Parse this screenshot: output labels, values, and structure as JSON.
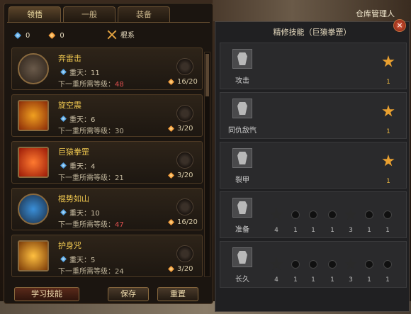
{
  "window": {
    "title": "精修技能（巨猿拳罡）",
    "warehouse_label": "仓库管理人",
    "close_label": "×"
  },
  "tabs": [
    {
      "label": "领悟"
    },
    {
      "label": "一般"
    },
    {
      "label": "装备"
    }
  ],
  "resources": {
    "blue_count": "0",
    "orange_count": "0",
    "weapon_label": "棍系"
  },
  "skills": [
    {
      "name": "奔雷击",
      "level_text": "重天：11",
      "req_prefix": "下一重所需等级：",
      "req_level": "48",
      "progress": "16/20",
      "req_red": true
    },
    {
      "name": "旋空震",
      "level_text": "重天：6",
      "req_prefix": "下一重所需等级：",
      "req_level": "30",
      "progress": "3/20",
      "req_red": false
    },
    {
      "name": "巨猿拳罡",
      "level_text": "重天：4",
      "req_prefix": "下一重所需等级：",
      "req_level": "21",
      "progress": "3/20",
      "req_red": false
    },
    {
      "name": "棍势如山",
      "level_text": "重天：10",
      "req_prefix": "下一重所需等级：",
      "req_level": "47",
      "progress": "16/20",
      "req_red": true
    },
    {
      "name": "护身咒",
      "level_text": "重天：5",
      "req_prefix": "下一重所需等级：",
      "req_level": "24",
      "progress": "3/20",
      "req_red": false
    }
  ],
  "buttons": {
    "learn": "学习技能",
    "save": "保存",
    "reset": "重置"
  },
  "refine": [
    {
      "label": "攻击",
      "counts": [
        "1"
      ]
    },
    {
      "label": "同仇敌忾",
      "counts": [
        "1"
      ]
    },
    {
      "label": "裂甲",
      "counts": [
        "1"
      ]
    },
    {
      "label": "准备",
      "counts": [
        "4",
        "1",
        "1",
        "1",
        "3",
        "1",
        "1"
      ]
    },
    {
      "label": "长久",
      "counts": [
        "4",
        "1",
        "1",
        "1",
        "3",
        "1",
        "1"
      ]
    }
  ],
  "colors": {
    "gold": "#f0c850",
    "accent_orange": "#e9a030",
    "warning_red": "#e05050"
  }
}
